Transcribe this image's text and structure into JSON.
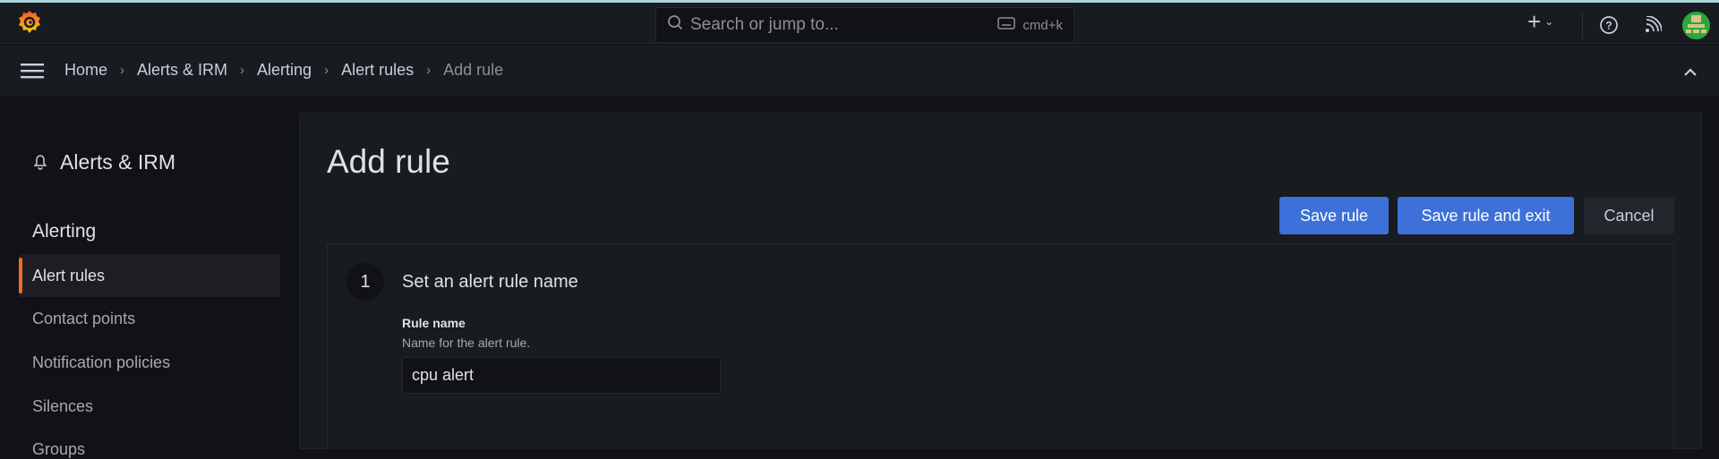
{
  "topbar": {
    "search_placeholder": "Search or jump to...",
    "shortcut": "cmd+k"
  },
  "breadcrumb": [
    "Home",
    "Alerts & IRM",
    "Alerting",
    "Alert rules",
    "Add rule"
  ],
  "sidebar": {
    "section_title": "Alerts & IRM",
    "group": "Alerting",
    "items": [
      {
        "label": "Alert rules",
        "active": true
      },
      {
        "label": "Contact points"
      },
      {
        "label": "Notification policies"
      },
      {
        "label": "Silences"
      },
      {
        "label": "Groups"
      }
    ]
  },
  "page": {
    "title": "Add rule",
    "save_label": "Save rule",
    "save_exit_label": "Save rule and exit",
    "cancel_label": "Cancel"
  },
  "step": {
    "number": "1",
    "title": "Set an alert rule name",
    "field_label": "Rule name",
    "field_hint": "Name for the alert rule.",
    "field_value": "cpu alert"
  },
  "colors": {
    "accent": "#3d71d9",
    "active_marker": "#f46b2b"
  }
}
